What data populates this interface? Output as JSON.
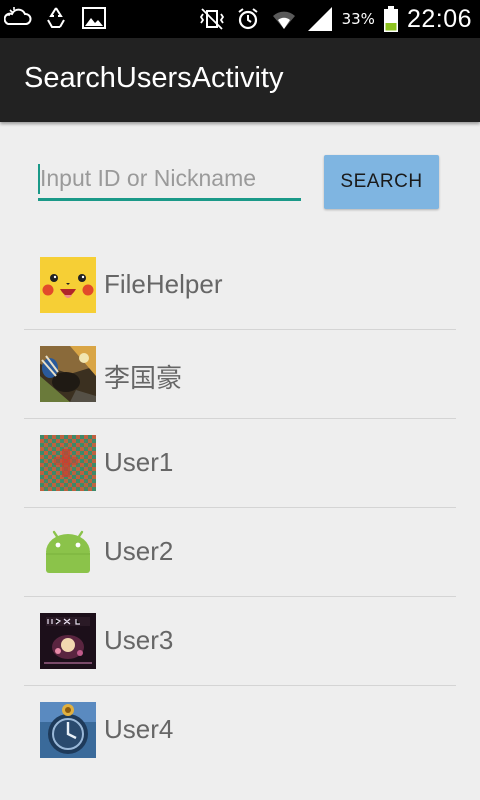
{
  "status_bar": {
    "left_icons": [
      "cloud-icon",
      "recycle-icon",
      "image-icon"
    ],
    "right_icons": [
      "vibrate-icon",
      "alarm-icon",
      "wifi-icon",
      "signal-icon",
      "battery-icon"
    ],
    "battery": "33%",
    "time": "22:06"
  },
  "app_bar": {
    "title": "SearchUsersActivity"
  },
  "search": {
    "placeholder": "Input ID or Nickname",
    "value": "",
    "button_label": "SEARCH"
  },
  "users": [
    {
      "name": "FileHelper",
      "avatar": "pikachu-avatar"
    },
    {
      "name": "李国豪",
      "avatar": "racing-game-avatar"
    },
    {
      "name": "User1",
      "avatar": "checker-pattern-avatar"
    },
    {
      "name": "User2",
      "avatar": "android-robot-avatar"
    },
    {
      "name": "User3",
      "avatar": "album-art-avatar"
    },
    {
      "name": "User4",
      "avatar": "clock-face-avatar"
    }
  ],
  "colors": {
    "accent": "#1a9988",
    "action_bar": "#222222",
    "button": "#7fb5e1",
    "background": "#eeeeee"
  }
}
